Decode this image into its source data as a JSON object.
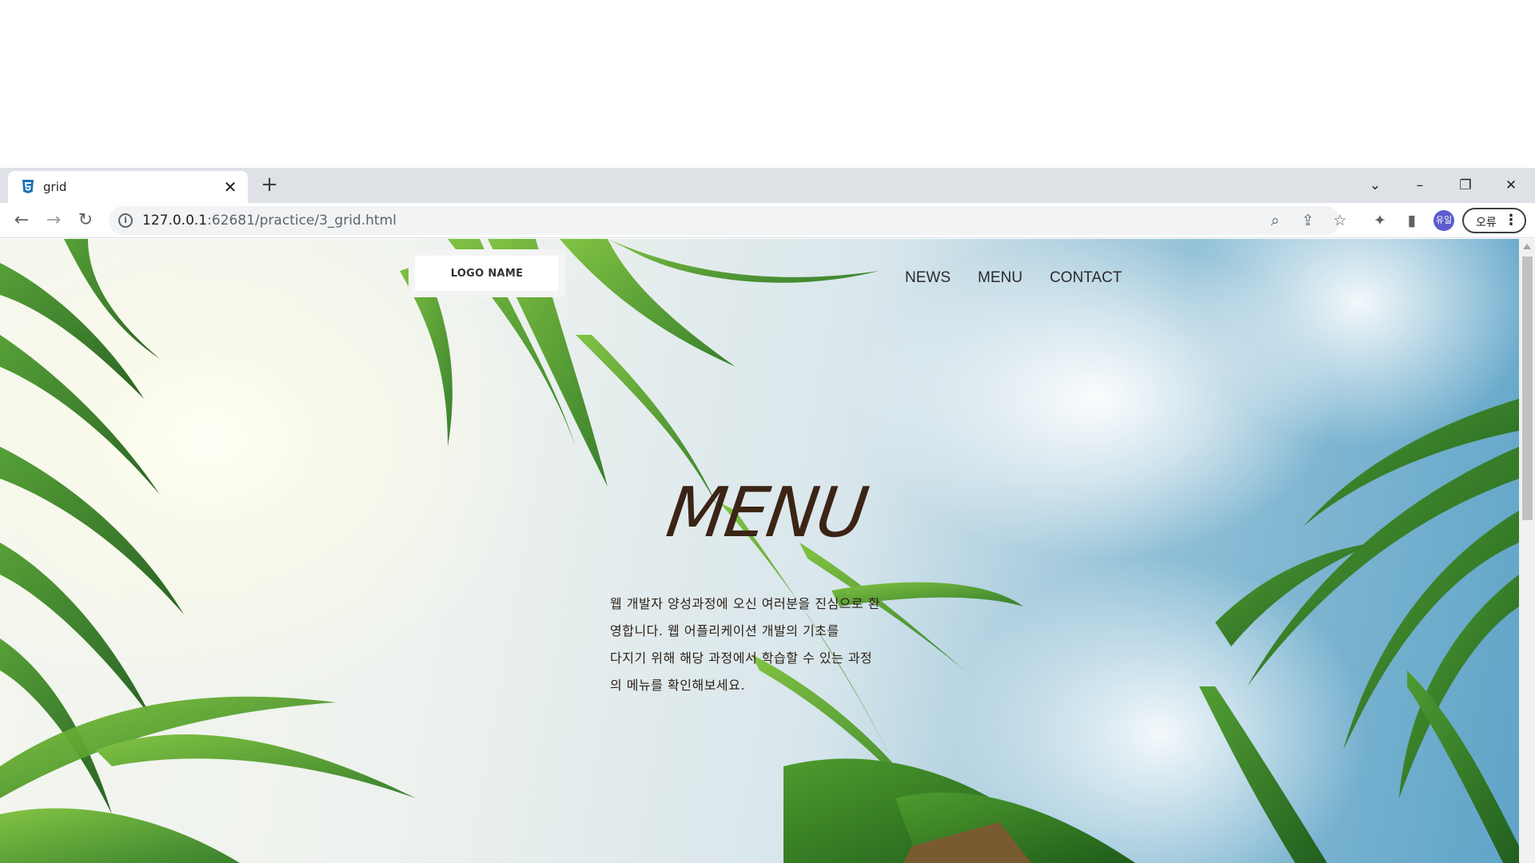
{
  "browser": {
    "tab": {
      "title": "grid",
      "favicon": "css3-icon",
      "close_label": "✕"
    },
    "new_tab_label": "+",
    "window_controls": {
      "tab_search": "⌄",
      "minimize": "–",
      "restore": "❐",
      "close": "✕"
    },
    "toolbar": {
      "back": "←",
      "forward": "→",
      "reload": "↻",
      "url_host": "127.0.0.1",
      "url_path": ":62681/practice/3_grid.html",
      "zoom_icon": "⌕",
      "share_icon": "⇪",
      "bookmark_icon": "☆",
      "extensions_icon": "✦",
      "sidepanel_icon": "▮",
      "profile_initials": "유일",
      "error_label": "오류",
      "menu_icon": "⋮"
    }
  },
  "page": {
    "logo": "LOGO NAME",
    "nav": [
      "NEWS",
      "MENU",
      "CONTACT"
    ],
    "hero_title": "MENU",
    "hero_lines": [
      "웹 개발자 양성과정에 오신 여러분을 진심으로 환",
      "영합니다. 웹 어플리케이션 개발의 기초를",
      "다지기 위해 해당 과정에서 학습할 수 있는 과정",
      "의 메뉴를 확인해보세요."
    ],
    "colors": {
      "title": "#3b2415",
      "text": "#2a1f15",
      "palm_green": "#3d8a2a",
      "sky": "#5fa4c8"
    }
  }
}
